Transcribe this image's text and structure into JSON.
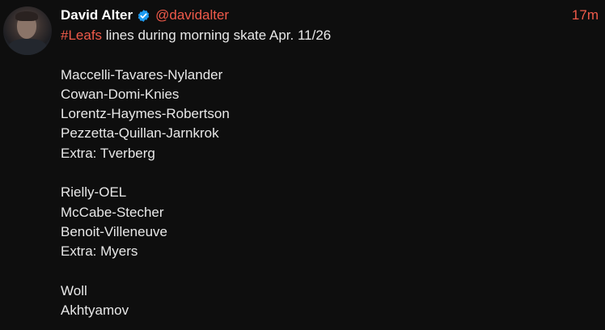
{
  "author": {
    "display_name": "David Alter",
    "handle": "@davidalter",
    "verified": true
  },
  "timestamp": "17m",
  "post": {
    "hashtag": "#Leafs",
    "headline_rest": " lines during morning skate Apr. 11/26",
    "forwards": [
      "Maccelli-Tavares-Nylander",
      "Cowan-Domi-Knies",
      "Lorentz-Haymes-Robertson",
      "Pezzetta-Quillan-Jarnkrok",
      "Extra: Tverberg"
    ],
    "defense": [
      "Rielly-OEL",
      "McCabe-Stecher",
      "Benoit-Villeneuve",
      "Extra: Myers"
    ],
    "goalies": [
      "Woll",
      "Akhtyamov"
    ]
  },
  "colors": {
    "background": "#0e0e0e",
    "accent": "#f05a4a",
    "verified": "#1d9bf0",
    "text": "#e8e8e8"
  },
  "icons": {
    "verified": "verified-badge-icon"
  }
}
